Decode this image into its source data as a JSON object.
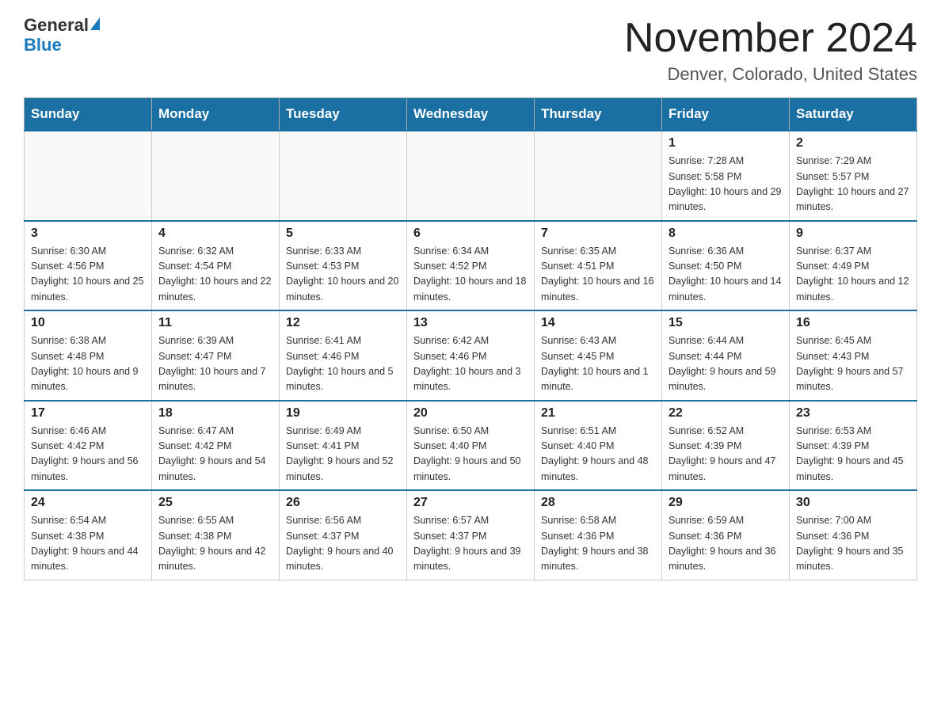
{
  "header": {
    "logo_general": "General",
    "logo_blue": "Blue",
    "month_title": "November 2024",
    "location": "Denver, Colorado, United States"
  },
  "days_of_week": [
    "Sunday",
    "Monday",
    "Tuesday",
    "Wednesday",
    "Thursday",
    "Friday",
    "Saturday"
  ],
  "weeks": [
    [
      {
        "day": "",
        "info": ""
      },
      {
        "day": "",
        "info": ""
      },
      {
        "day": "",
        "info": ""
      },
      {
        "day": "",
        "info": ""
      },
      {
        "day": "",
        "info": ""
      },
      {
        "day": "1",
        "info": "Sunrise: 7:28 AM\nSunset: 5:58 PM\nDaylight: 10 hours and 29 minutes."
      },
      {
        "day": "2",
        "info": "Sunrise: 7:29 AM\nSunset: 5:57 PM\nDaylight: 10 hours and 27 minutes."
      }
    ],
    [
      {
        "day": "3",
        "info": "Sunrise: 6:30 AM\nSunset: 4:56 PM\nDaylight: 10 hours and 25 minutes."
      },
      {
        "day": "4",
        "info": "Sunrise: 6:32 AM\nSunset: 4:54 PM\nDaylight: 10 hours and 22 minutes."
      },
      {
        "day": "5",
        "info": "Sunrise: 6:33 AM\nSunset: 4:53 PM\nDaylight: 10 hours and 20 minutes."
      },
      {
        "day": "6",
        "info": "Sunrise: 6:34 AM\nSunset: 4:52 PM\nDaylight: 10 hours and 18 minutes."
      },
      {
        "day": "7",
        "info": "Sunrise: 6:35 AM\nSunset: 4:51 PM\nDaylight: 10 hours and 16 minutes."
      },
      {
        "day": "8",
        "info": "Sunrise: 6:36 AM\nSunset: 4:50 PM\nDaylight: 10 hours and 14 minutes."
      },
      {
        "day": "9",
        "info": "Sunrise: 6:37 AM\nSunset: 4:49 PM\nDaylight: 10 hours and 12 minutes."
      }
    ],
    [
      {
        "day": "10",
        "info": "Sunrise: 6:38 AM\nSunset: 4:48 PM\nDaylight: 10 hours and 9 minutes."
      },
      {
        "day": "11",
        "info": "Sunrise: 6:39 AM\nSunset: 4:47 PM\nDaylight: 10 hours and 7 minutes."
      },
      {
        "day": "12",
        "info": "Sunrise: 6:41 AM\nSunset: 4:46 PM\nDaylight: 10 hours and 5 minutes."
      },
      {
        "day": "13",
        "info": "Sunrise: 6:42 AM\nSunset: 4:46 PM\nDaylight: 10 hours and 3 minutes."
      },
      {
        "day": "14",
        "info": "Sunrise: 6:43 AM\nSunset: 4:45 PM\nDaylight: 10 hours and 1 minute."
      },
      {
        "day": "15",
        "info": "Sunrise: 6:44 AM\nSunset: 4:44 PM\nDaylight: 9 hours and 59 minutes."
      },
      {
        "day": "16",
        "info": "Sunrise: 6:45 AM\nSunset: 4:43 PM\nDaylight: 9 hours and 57 minutes."
      }
    ],
    [
      {
        "day": "17",
        "info": "Sunrise: 6:46 AM\nSunset: 4:42 PM\nDaylight: 9 hours and 56 minutes."
      },
      {
        "day": "18",
        "info": "Sunrise: 6:47 AM\nSunset: 4:42 PM\nDaylight: 9 hours and 54 minutes."
      },
      {
        "day": "19",
        "info": "Sunrise: 6:49 AM\nSunset: 4:41 PM\nDaylight: 9 hours and 52 minutes."
      },
      {
        "day": "20",
        "info": "Sunrise: 6:50 AM\nSunset: 4:40 PM\nDaylight: 9 hours and 50 minutes."
      },
      {
        "day": "21",
        "info": "Sunrise: 6:51 AM\nSunset: 4:40 PM\nDaylight: 9 hours and 48 minutes."
      },
      {
        "day": "22",
        "info": "Sunrise: 6:52 AM\nSunset: 4:39 PM\nDaylight: 9 hours and 47 minutes."
      },
      {
        "day": "23",
        "info": "Sunrise: 6:53 AM\nSunset: 4:39 PM\nDaylight: 9 hours and 45 minutes."
      }
    ],
    [
      {
        "day": "24",
        "info": "Sunrise: 6:54 AM\nSunset: 4:38 PM\nDaylight: 9 hours and 44 minutes."
      },
      {
        "day": "25",
        "info": "Sunrise: 6:55 AM\nSunset: 4:38 PM\nDaylight: 9 hours and 42 minutes."
      },
      {
        "day": "26",
        "info": "Sunrise: 6:56 AM\nSunset: 4:37 PM\nDaylight: 9 hours and 40 minutes."
      },
      {
        "day": "27",
        "info": "Sunrise: 6:57 AM\nSunset: 4:37 PM\nDaylight: 9 hours and 39 minutes."
      },
      {
        "day": "28",
        "info": "Sunrise: 6:58 AM\nSunset: 4:36 PM\nDaylight: 9 hours and 38 minutes."
      },
      {
        "day": "29",
        "info": "Sunrise: 6:59 AM\nSunset: 4:36 PM\nDaylight: 9 hours and 36 minutes."
      },
      {
        "day": "30",
        "info": "Sunrise: 7:00 AM\nSunset: 4:36 PM\nDaylight: 9 hours and 35 minutes."
      }
    ]
  ]
}
